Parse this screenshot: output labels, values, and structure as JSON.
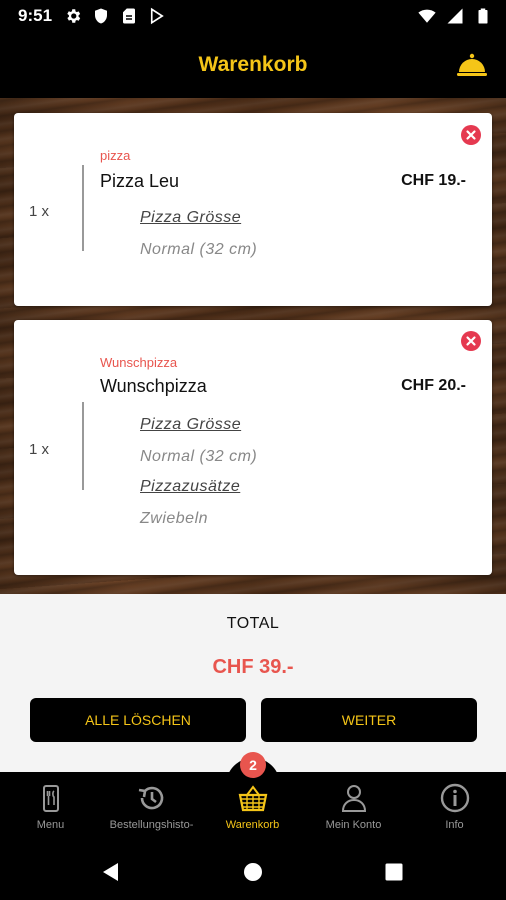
{
  "status_bar": {
    "time": "9:51"
  },
  "app_bar": {
    "title": "Warenkorb"
  },
  "cart_items": [
    {
      "quantity": "1 x",
      "category": "pizza",
      "name": "Pizza Leu",
      "price": "CHF 19.-",
      "options": [
        {
          "heading": "Pizza Grösse",
          "value": "Normal (32 cm)"
        }
      ]
    },
    {
      "quantity": "1 x",
      "category": "Wunschpizza",
      "name": "Wunschpizza",
      "price": "CHF 20.-",
      "options": [
        {
          "heading": "Pizza Grösse",
          "value": "Normal (32 cm)"
        },
        {
          "heading": "Pizzazusätze",
          "value": "Zwiebeln"
        }
      ]
    }
  ],
  "summary": {
    "total_label": "TOTAL",
    "total_value": "CHF 39.-",
    "clear_label": "ALLE LÖSCHEN",
    "next_label": "WEITER"
  },
  "tab_bar": {
    "badge_count": "2",
    "tabs": [
      {
        "label": "Menu",
        "icon": "phone-menu-icon"
      },
      {
        "label": "Bestellungshisto-",
        "icon": "history-icon"
      },
      {
        "label": "Warenkorb",
        "icon": "basket-icon",
        "active": true
      },
      {
        "label": "Mein Konto",
        "icon": "person-icon"
      },
      {
        "label": "Info",
        "icon": "info-icon"
      }
    ]
  },
  "colors": {
    "accent": "#f5c518",
    "highlight": "#e8554e",
    "remove": "#e53950"
  }
}
